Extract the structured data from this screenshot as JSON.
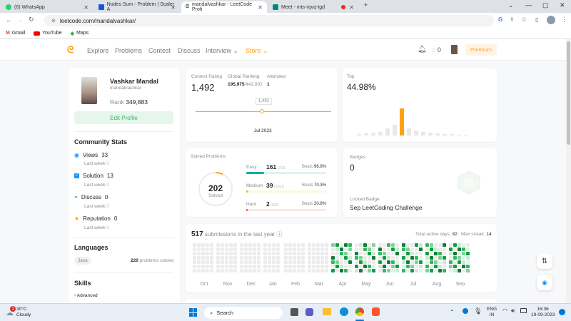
{
  "browser": {
    "tabs": [
      {
        "title": "(6) WhatsApp"
      },
      {
        "title": "Nodes Sum - Problem | Scaler A"
      },
      {
        "title": "mandalvashkar - LeetCode Profi"
      },
      {
        "title": "Meet - mts-rqvq-tgd"
      }
    ],
    "url": "leetcode.com/mandalvashkar/",
    "bookmarks": [
      "Gmail",
      "YouTube",
      "Maps"
    ]
  },
  "nav": {
    "links": [
      "Explore",
      "Problems",
      "Contest",
      "Discuss",
      "Interview",
      "Store"
    ],
    "streak_count": "0",
    "premium": "Premium"
  },
  "profile": {
    "name": "Vashkar Mandal",
    "username": "mandalvashkar",
    "rank_label": "Rank",
    "rank": "349,883",
    "edit": "Edit Profile"
  },
  "community": {
    "title": "Community Stats",
    "stats": [
      {
        "label": "Views",
        "value": "33",
        "sub": "Last week",
        "subval": "0"
      },
      {
        "label": "Solution",
        "value": "13",
        "sub": "Last week",
        "subval": "0"
      },
      {
        "label": "Discuss",
        "value": "0",
        "sub": "Last week",
        "subval": "0"
      },
      {
        "label": "Reputation",
        "value": "0",
        "sub": "Last week",
        "subval": "0"
      }
    ]
  },
  "languages": {
    "title": "Languages",
    "lang": "Java",
    "count": "220",
    "suffix": "problems solved"
  },
  "skills": {
    "title": "Skills",
    "first": "Advanced"
  },
  "contest": {
    "rating_label": "Contest Rating",
    "rating": "1,492",
    "global_label": "Global Ranking",
    "global": "195,975",
    "global_total": "/442,802",
    "attended_label": "Attended",
    "attended": "1",
    "tooltip": "1,492",
    "date": "Jul 2023",
    "top_label": "Top",
    "top": "44.98%",
    "histogram": [
      2,
      3,
      4,
      5,
      9,
      14,
      36,
      9,
      7,
      5,
      4,
      3,
      2,
      2,
      1,
      1
    ],
    "highlight_index": 6
  },
  "solved": {
    "title": "Solved Problems",
    "total": "202",
    "total_label": "Solved",
    "rows": [
      {
        "level": "Easy",
        "count": "161",
        "total": "/718",
        "beats_label": "Beats",
        "beats": "96.8%",
        "fraction": 0.224,
        "color": "#00af9b"
      },
      {
        "level": "Medium",
        "count": "39",
        "total": "/1515",
        "beats_label": "Beats",
        "beats": "70.3%",
        "fraction": 0.026,
        "color": "#ffb800"
      },
      {
        "level": "Hard",
        "count": "2",
        "total": "/629",
        "beats_label": "Beats",
        "beats": "20.8%",
        "fraction": 0.003,
        "color": "#ef4743"
      }
    ]
  },
  "badges": {
    "title": "Badges",
    "count": "0",
    "locked_label": "Locked Badge",
    "locked_name": "Sep LeetCoding Challenge"
  },
  "submissions": {
    "count": "517",
    "text": "submissions in the last year",
    "active_label": "Total active days:",
    "active": "82",
    "streak_label": "Max streak:",
    "streak": "14",
    "months": [
      "Oct",
      "Nov",
      "Dec",
      "Jan",
      "Feb",
      "Mar",
      "Apr",
      "May",
      "Jun",
      "Jul",
      "Aug",
      "Sep"
    ]
  },
  "taskbar": {
    "temp": "30°C",
    "weather": "Cloudy",
    "search": "Search",
    "lang1": "ENG",
    "lang2": "IN",
    "time": "16:36",
    "date": "19-09-2023",
    "weather_badge": "1"
  },
  "colors": {
    "accent": "#ffa116",
    "green": "#2cbb5d",
    "easy": "#00af9b",
    "medium": "#ffb800",
    "hard": "#ef4743"
  }
}
